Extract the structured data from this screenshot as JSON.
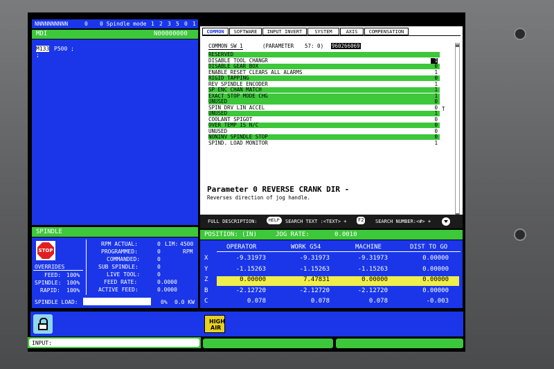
{
  "status_bar": {
    "id": "NNNNNNNNNN",
    "code": "0",
    "mode_label": "0 Spindle mode",
    "modes": [
      "1",
      "2",
      "3",
      "5",
      "0",
      "1"
    ]
  },
  "mdi": {
    "title": "MDI",
    "program_number": "N00000000",
    "line_code": "M133",
    "line_rest": "P500 ;",
    "line2": ";"
  },
  "tabs": [
    "COMMON",
    "SOFTWARE",
    "INPUT INVERT",
    "SYSTEM",
    "AXIS",
    "COMPENSATION"
  ],
  "params": {
    "header_label": "COMMON SW 1",
    "header_paren": "(PARAMETER",
    "header_num": "57: 0)",
    "header_value": "960266069",
    "rows": [
      {
        "label": "RESERVED",
        "value": ""
      },
      {
        "label": "DISABLE TOOL CHANGR",
        "value": "1"
      },
      {
        "label": "DISABLE GEAR BOX",
        "value": "0"
      },
      {
        "label": "ENABLE RESET CLEARS ALL ALARMS",
        "value": "1"
      },
      {
        "label": "RIGID TAPPING",
        "value": "0"
      },
      {
        "label": "REV SPINDLE ENCODER",
        "value": "1"
      },
      {
        "label": "SP ENC CHAN MATCH",
        "value": "1"
      },
      {
        "label": "EXACT STOP MODE CHG",
        "value": "1"
      },
      {
        "label": "UNUSED",
        "value": "0"
      },
      {
        "label": "SPIN DRV LIN ACCEL",
        "value": "0"
      },
      {
        "label": "UNUSED",
        "value": "1"
      },
      {
        "label": "COOLANT SPIGOT",
        "value": "0"
      },
      {
        "label": "OVER TEMP IS N/C",
        "value": "0"
      },
      {
        "label": "UNUSED",
        "value": "0"
      },
      {
        "label": "NONINV SPINDLE STOP",
        "value": "0"
      },
      {
        "label": "SPIND. LOAD MONITOR",
        "value": "1"
      }
    ],
    "cursor_mark": "T",
    "desc_title": "Parameter 0 REVERSE CRANK DIR -",
    "desc_text": "Reverses direction of jog handle.",
    "help_bar": {
      "full_desc": "FULL DESCRIPTION:",
      "help_key": "HELP",
      "search_text": "SEARCH TEXT :<TEXT> +",
      "f2_key": "F2",
      "search_number": "SEARCH NUMBER:<#> +"
    }
  },
  "spindle": {
    "title": "SPINDLE",
    "stop_label": "STOP",
    "overrides_label": "OVERRIDES",
    "overrides": [
      {
        "label": "FEED:",
        "value": "100%"
      },
      {
        "label": "SPINDLE:",
        "value": "100%"
      },
      {
        "label": "RAPID:",
        "value": "100%"
      }
    ],
    "rpm_actual_label": "RPM ACTUAL:",
    "rpm_actual": "0",
    "lim_label": "LIM:",
    "lim_value": "4500",
    "programmed_label": "PROGRAMMED:",
    "programmed": "0",
    "rpm_unit": "RPM",
    "commanded_label": "COMMANDED:",
    "commanded": "0",
    "sub_spindle_label": "SUB SPINDLE:",
    "sub_spindle": "0",
    "live_tool_label": "LIVE TOOL:",
    "live_tool": "0",
    "feed_rate_label": "FEED RATE:",
    "feed_rate": "0.0000",
    "active_feed_label": "ACTIVE FEED:",
    "active_feed": "0.0000",
    "load_label": "SPINDLE LOAD:",
    "load_percent": "0%",
    "load_kw": "0.0 KW"
  },
  "position": {
    "title": "POSITION: (IN)",
    "jog_label": "JOG RATE:",
    "jog_value": "0.0010",
    "columns": [
      "OPERATOR",
      "WORK G54",
      "MACHINE",
      "DIST TO GO"
    ],
    "rows": [
      {
        "axis": "X",
        "values": [
          "-9.31973",
          "-9.31973",
          "-9.31973",
          "0.00000"
        ]
      },
      {
        "axis": "Y",
        "values": [
          "-1.15263",
          "-1.15263",
          "-1.15263",
          "0.00000"
        ]
      },
      {
        "axis": "Z",
        "values": [
          "0.00000",
          "7.47831",
          "0.00000",
          "0.00000"
        ]
      },
      {
        "axis": "B",
        "values": [
          "-2.12720",
          "-2.12720",
          "-2.12720",
          "0.00000"
        ]
      },
      {
        "axis": "C",
        "values": [
          "0.078",
          "0.078",
          "0.078",
          "-0.003"
        ]
      }
    ]
  },
  "bottom": {
    "high_air_1": "HIGH",
    "high_air_2": "AIR",
    "input_label": "INPUT:"
  }
}
